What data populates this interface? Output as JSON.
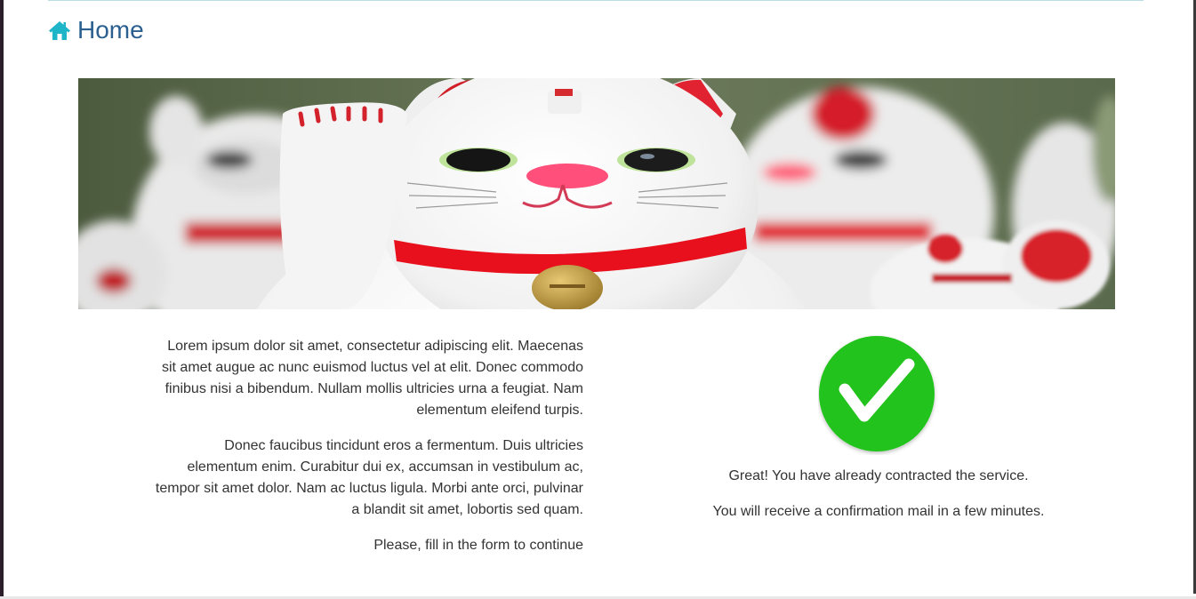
{
  "header": {
    "title": "Home",
    "icon": "home-icon",
    "accent_color": "#1fb5c9",
    "title_color": "#2a5f8f"
  },
  "banner": {
    "icon": "lucky-cat-image"
  },
  "content": {
    "paragraphs": [
      "Lorem ipsum dolor sit amet, consectetur adipiscing elit. Maecenas sit amet augue ac nunc euismod luctus vel at elit. Donec commodo finibus nisi a bibendum. Nullam mollis ultricies urna a feugiat. Nam elementum eleifend turpis.",
      "Donec faucibus tincidunt eros a fermentum. Duis ultricies elementum enim. Curabitur dui ex, accumsan in vestibulum ac, tempor sit amet dolor. Nam ac luctus ligula. Morbi ante orci, pulvinar a blandit sit amet, lobortis sed quam.",
      "Please, fill in the form to continue"
    ]
  },
  "status": {
    "icon": "success-check-icon",
    "color": "#22c31a",
    "message_primary": "Great! You have already contracted the service.",
    "message_secondary": "You will receive a confirmation mail in a few minutes."
  }
}
